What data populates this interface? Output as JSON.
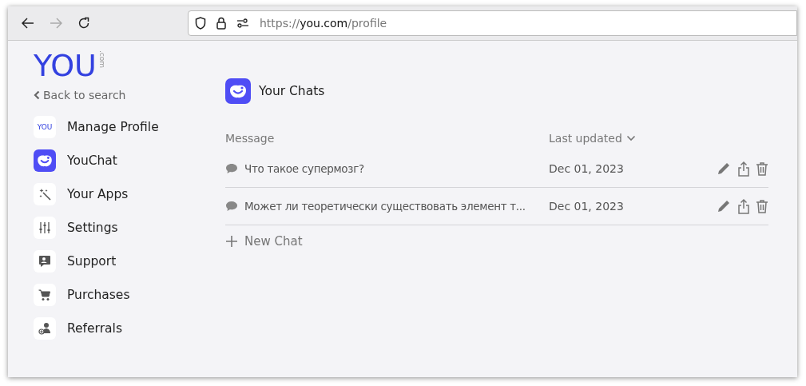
{
  "browser": {
    "url_prefix": "https://",
    "url_host": "you.com",
    "url_path": "/profile",
    "forward_disabled": true
  },
  "logo": {
    "text": "YOU",
    "suffix": ".com"
  },
  "back_link": "Back to search",
  "sidebar": {
    "items": [
      {
        "label": "Manage Profile",
        "kind": "profile",
        "icon_text": "YOU"
      },
      {
        "label": "YouChat",
        "kind": "chat"
      },
      {
        "label": "Your Apps",
        "kind": "apps"
      },
      {
        "label": "Settings",
        "kind": "settings"
      },
      {
        "label": "Support",
        "kind": "support"
      },
      {
        "label": "Purchases",
        "kind": "purchases"
      },
      {
        "label": "Referrals",
        "kind": "referrals"
      }
    ]
  },
  "chats": {
    "title": "Your Chats",
    "columns": [
      "Message",
      "Last updated"
    ],
    "rows": [
      {
        "message": "Что такое супермозг?",
        "updated": "Dec 01, 2023"
      },
      {
        "message": "Может ли теоретически существовать элемент т...",
        "updated": "Dec 01, 2023"
      }
    ],
    "new_chat": "New Chat"
  }
}
